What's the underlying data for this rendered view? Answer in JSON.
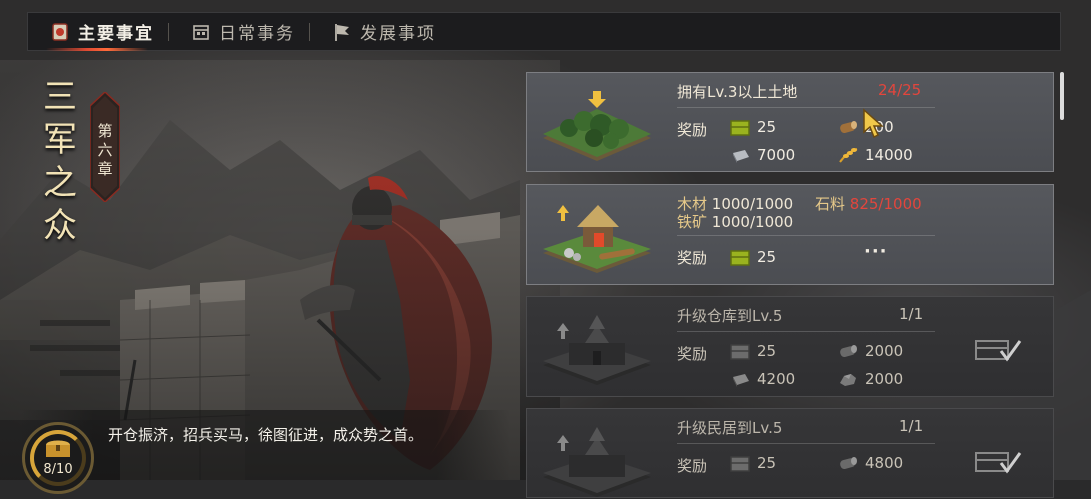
{
  "tabs": [
    {
      "label": "主要事宜",
      "icon": "scroll-icon",
      "active": true
    },
    {
      "label": "日常事务",
      "icon": "calendar-icon",
      "active": false
    },
    {
      "label": "发展事项",
      "icon": "banner-flag-icon",
      "active": false
    }
  ],
  "chapter": {
    "title_chars": [
      "三",
      "军",
      "之",
      "众"
    ],
    "badge_chars": [
      "第",
      "六",
      "章"
    ]
  },
  "story": {
    "text": "开仓振济，招兵买马，徐图征进，成众势之首。",
    "chest_progress": "8/10",
    "chest_icon": "treasure-chest-icon"
  },
  "tasks": [
    {
      "title": "拥有Lv.3以上土地",
      "progress": "24/25",
      "reward_label": "奖励",
      "rewards": [
        {
          "icon": "supply-crate-icon",
          "amount": "25"
        },
        {
          "icon": "wood-log-icon",
          "amount": "200"
        },
        {
          "icon": "iron-ingot-icon",
          "amount": "7000"
        },
        {
          "icon": "grain-icon",
          "amount": "14000"
        }
      ]
    },
    {
      "requirements": {
        "wood_label": "木材",
        "wood_value": "1000/1000",
        "stone_label": "石料",
        "stone_value": "825/1000",
        "iron_label": "铁矿",
        "iron_value": "1000/1000"
      },
      "reward_label": "奖励",
      "rewards": [
        {
          "icon": "supply-crate-icon",
          "amount": "25"
        }
      ],
      "more": "···"
    },
    {
      "title": "升级仓库到Lv.5",
      "progress": "1/1",
      "reward_label": "奖励",
      "rewards": [
        {
          "icon": "supply-crate-icon",
          "amount": "25"
        },
        {
          "icon": "wood-log-icon",
          "amount": "2000"
        },
        {
          "icon": "iron-ingot-icon",
          "amount": "4200"
        },
        {
          "icon": "stone-icon",
          "amount": "2000"
        }
      ]
    },
    {
      "title": "升级民居到Lv.5",
      "progress": "1/1",
      "reward_label": "奖励",
      "rewards": [
        {
          "icon": "supply-crate-icon",
          "amount": "25"
        },
        {
          "icon": "wood-log-icon",
          "amount": "4800"
        }
      ]
    }
  ]
}
